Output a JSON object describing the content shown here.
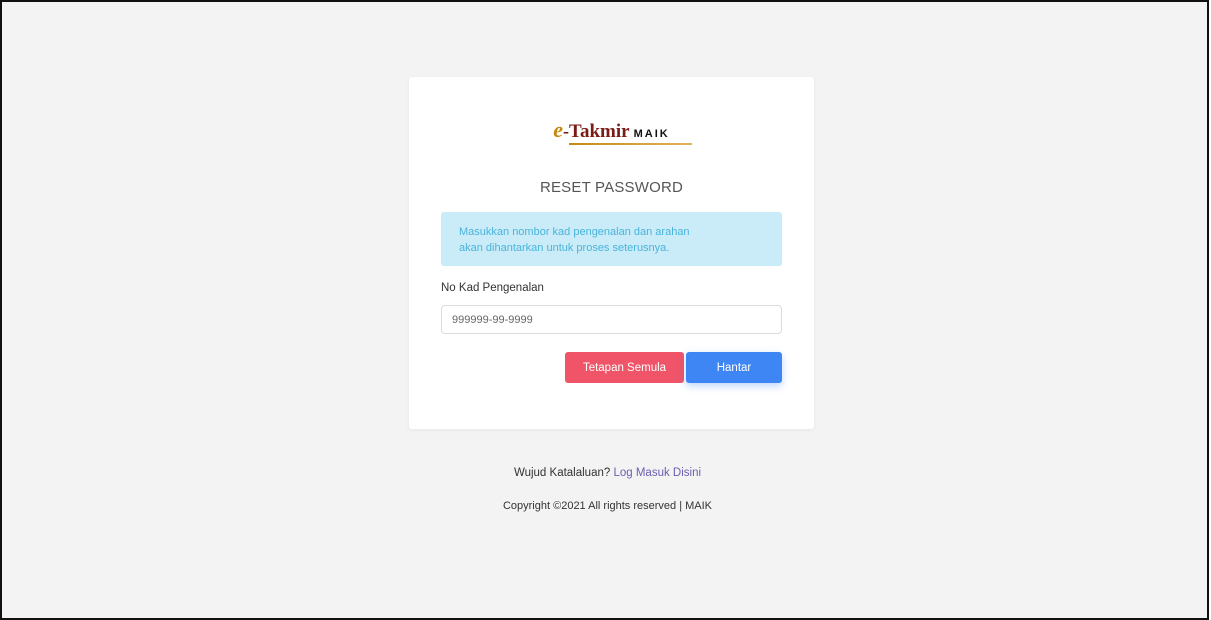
{
  "logo": {
    "e": "e",
    "dash": "-",
    "takmir": "Takmir",
    "maik": "MAIK"
  },
  "card": {
    "title": "RESET PASSWORD",
    "alert_line1": "Masukkan nombor kad pengenalan dan arahan",
    "alert_line2": "akan dihantarkan untuk proses seterusnya.",
    "ic_label": "No Kad Pengenalan",
    "ic_placeholder": "999999-99-9999",
    "ic_value": "",
    "reset_label": "Tetapan Semula",
    "submit_label": "Hantar"
  },
  "footer": {
    "login_prompt": "Wujud Katalaluan? ",
    "login_link": "Log Masuk Disini",
    "copyright": "Copyright ©2021 All rights reserved | MAIK"
  },
  "colors": {
    "background": "#f3f3f3",
    "alert_bg": "#c9ecf8",
    "alert_text": "#4ab3dc",
    "reset_button": "#ef5468",
    "submit_button": "#3f86f5",
    "link": "#6a5fb0"
  }
}
